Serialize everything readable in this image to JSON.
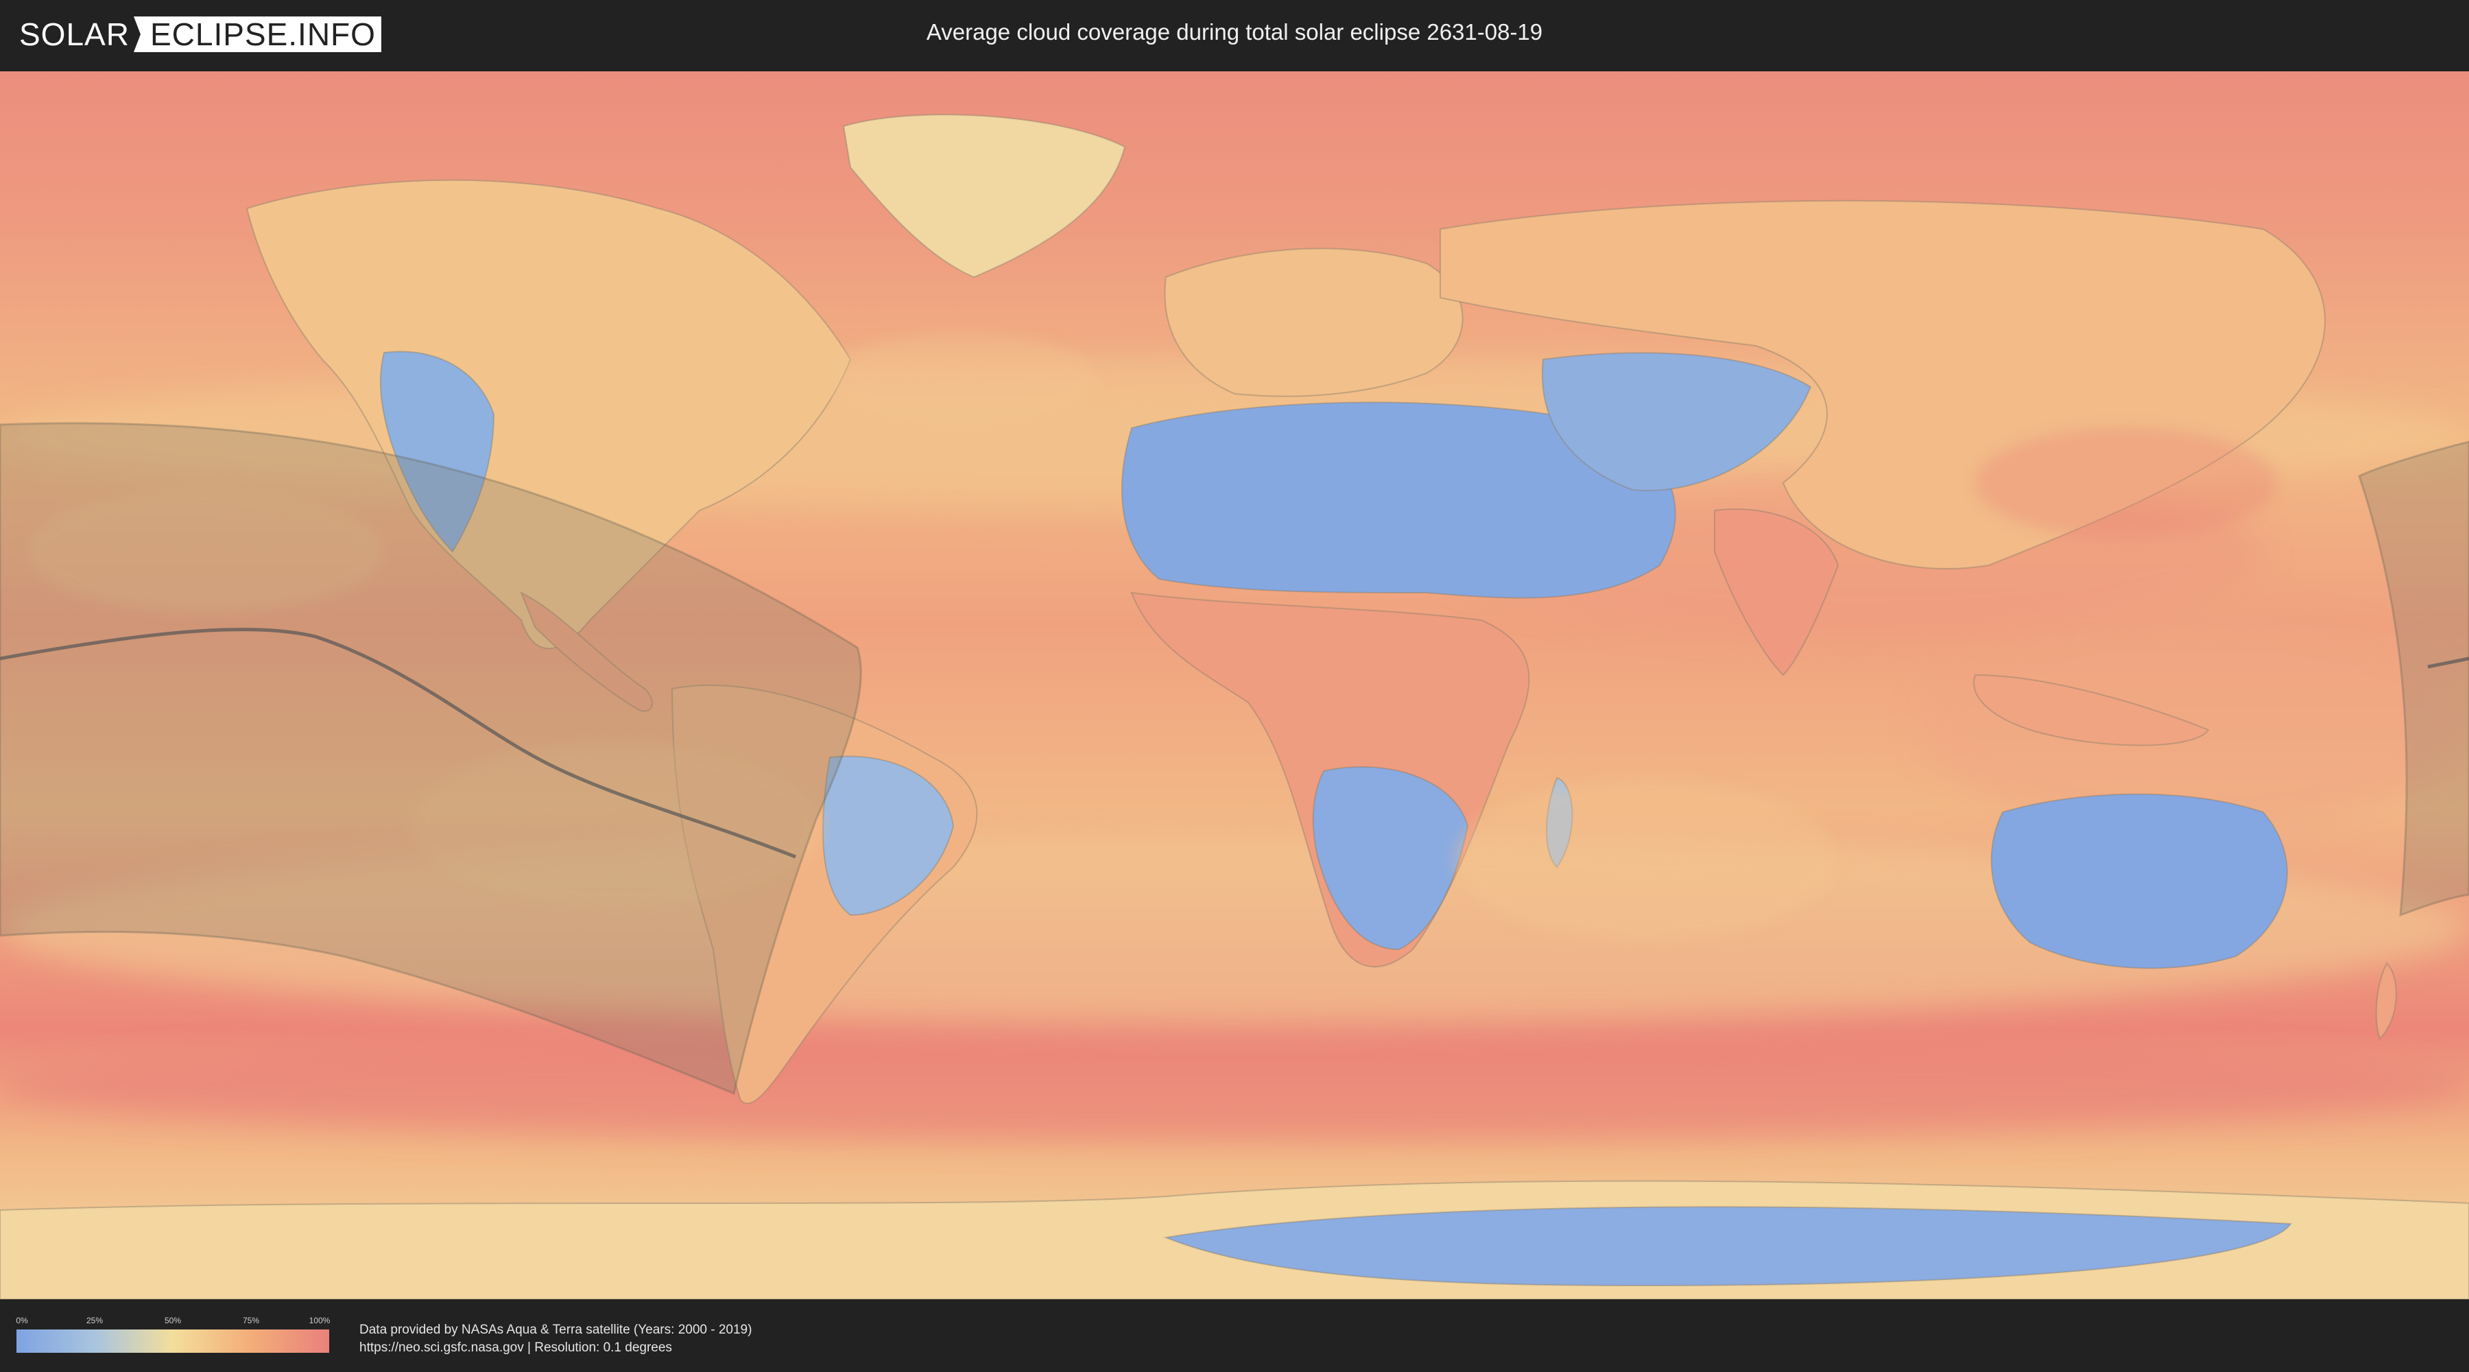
{
  "header": {
    "logo_part_a": "SOLAR",
    "logo_part_b": "ECLIPSE.INFO",
    "title": "Average cloud coverage during total solar eclipse 2631-08-19"
  },
  "map": {
    "kind": "cloud coverage world map (equirectangular)",
    "colors": {
      "clear": "#7ea3e2",
      "low": "#a9c4de",
      "mid": "#f3de9c",
      "high": "#f3ad78",
      "overcast": "#e9817c",
      "eclipse_shadow": "#8a8066",
      "central_line": "#555555"
    }
  },
  "legend": {
    "ticks": [
      "0%",
      "25%",
      "50%",
      "75%",
      "100%"
    ],
    "tick_values": [
      0,
      25,
      50,
      75,
      100
    ]
  },
  "footer": {
    "credit_line_1": "Data provided by NASAs Aqua & Terra satellite (Years: 2000 - 2019)",
    "credit_line_2": "https://neo.sci.gsfc.nasa.gov | Resolution: 0.1 degrees"
  }
}
